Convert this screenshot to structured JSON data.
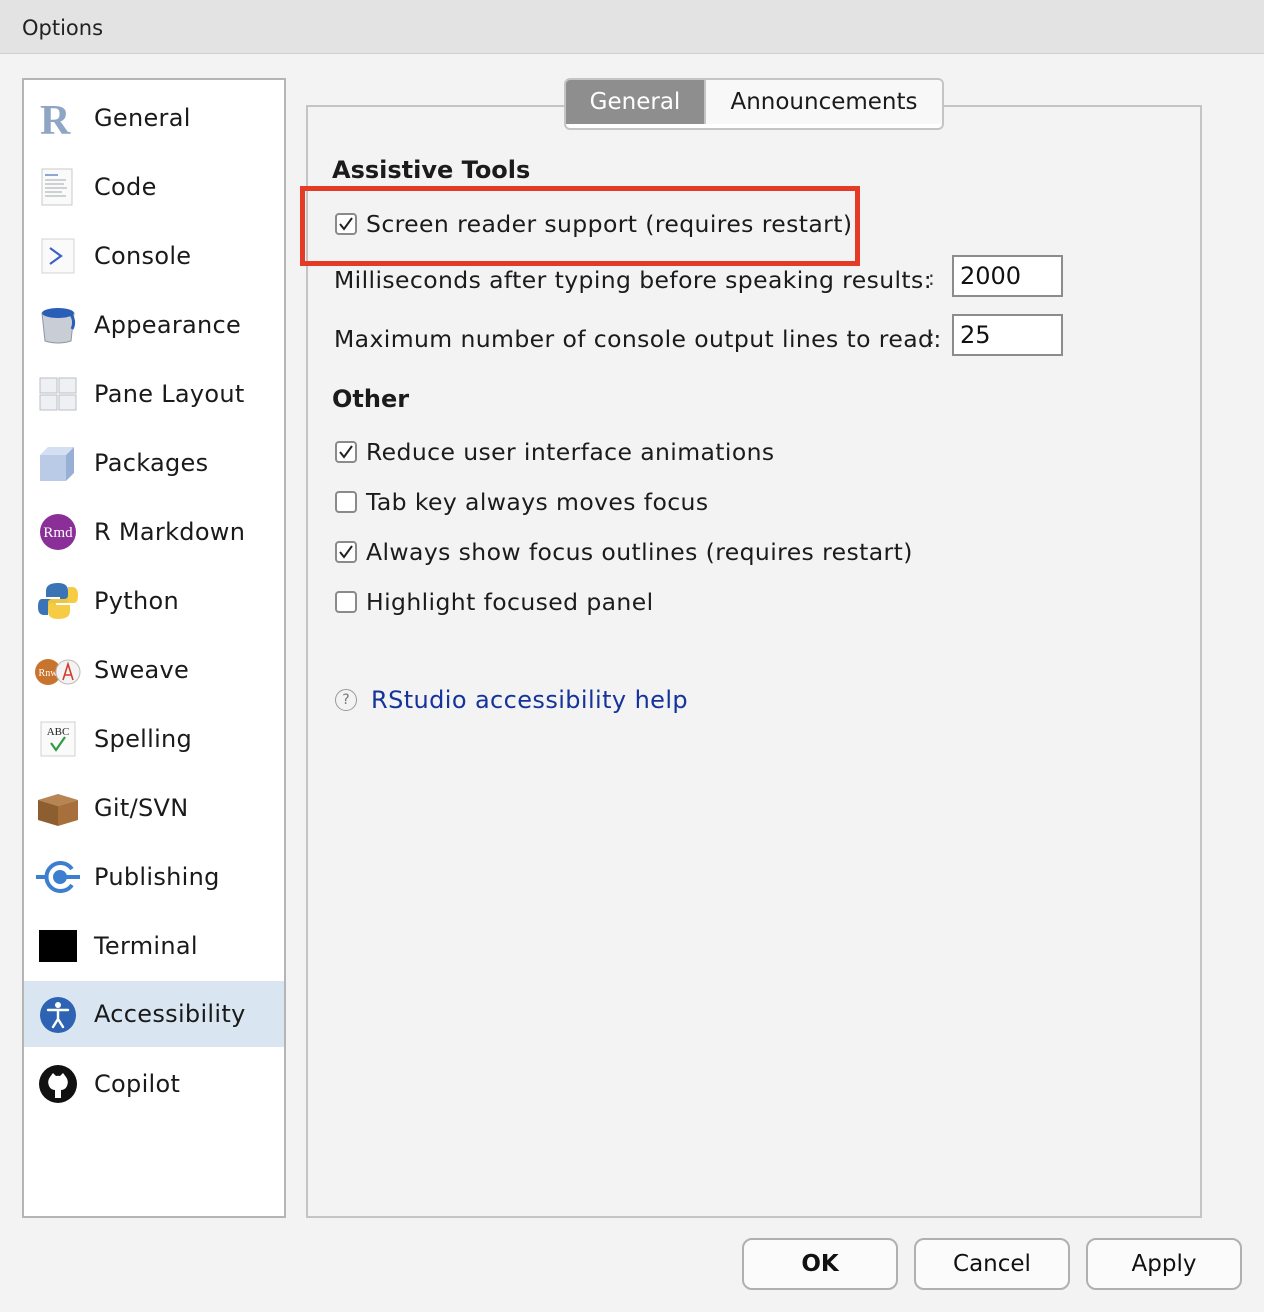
{
  "window": {
    "title": "Options"
  },
  "sidebar": {
    "items": [
      {
        "label": "General",
        "icon": "r-logo-icon"
      },
      {
        "label": "Code",
        "icon": "code-document-icon"
      },
      {
        "label": "Console",
        "icon": "console-prompt-icon"
      },
      {
        "label": "Appearance",
        "icon": "paint-bucket-icon"
      },
      {
        "label": "Pane Layout",
        "icon": "pane-grid-icon"
      },
      {
        "label": "Packages",
        "icon": "package-cube-icon"
      },
      {
        "label": "R Markdown",
        "icon": "rmd-icon"
      },
      {
        "label": "Python",
        "icon": "python-icon"
      },
      {
        "label": "Sweave",
        "icon": "sweave-pdf-icon"
      },
      {
        "label": "Spelling",
        "icon": "spelling-check-icon"
      },
      {
        "label": "Git/SVN",
        "icon": "git-box-icon"
      },
      {
        "label": "Publishing",
        "icon": "publishing-icon"
      },
      {
        "label": "Terminal",
        "icon": "terminal-icon"
      },
      {
        "label": "Accessibility",
        "icon": "accessibility-icon",
        "selected": true
      },
      {
        "label": "Copilot",
        "icon": "github-icon"
      }
    ]
  },
  "tabs": {
    "general": "General",
    "announcements": "Announcements",
    "active": "General"
  },
  "assistive": {
    "title": "Assistive Tools",
    "screen_reader": {
      "label": "Screen reader support (requires restart)",
      "checked": true
    },
    "typing_delay": {
      "label": "Milliseconds after typing before speaking results:",
      "colon": ":",
      "value": "2000"
    },
    "max_lines": {
      "label": "Maximum number of console output lines to read:",
      "colon": ":",
      "value": "25"
    }
  },
  "other": {
    "title": "Other",
    "options": [
      {
        "label": "Reduce user interface animations",
        "checked": true
      },
      {
        "label": "Tab key always moves focus",
        "checked": false
      },
      {
        "label": "Always show focus outlines (requires restart)",
        "checked": true
      },
      {
        "label": "Highlight focused panel",
        "checked": false
      }
    ]
  },
  "help": {
    "icon_glyph": "?",
    "link": "RStudio accessibility help"
  },
  "buttons": {
    "ok": "OK",
    "cancel": "Cancel",
    "apply": "Apply"
  },
  "colors": {
    "highlight": "#e33b26",
    "selected_bg": "#d9e6f2",
    "link": "#15339a"
  }
}
